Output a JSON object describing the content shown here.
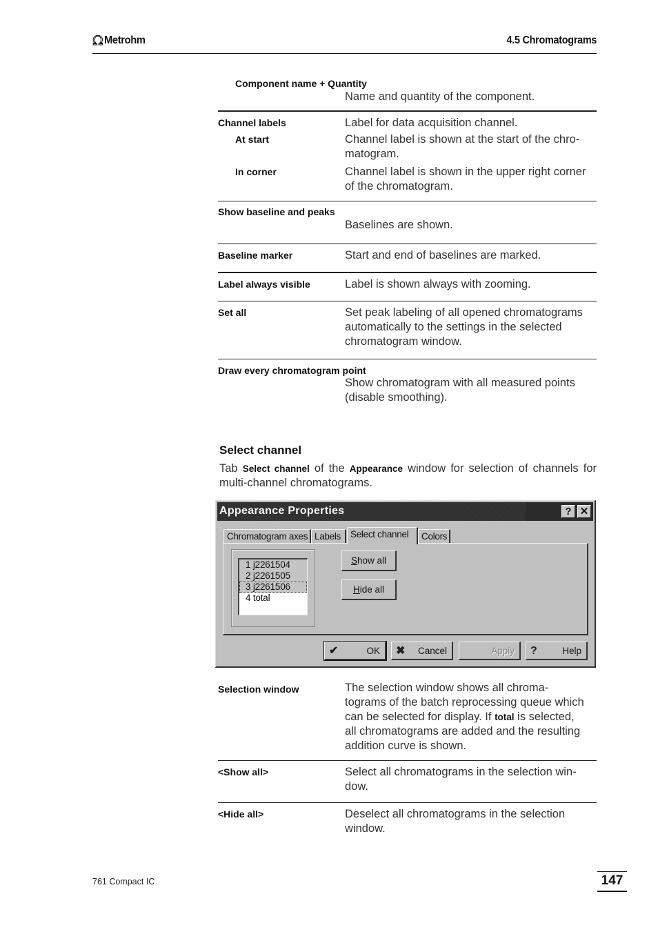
{
  "header": {
    "logo_symbol": "Ω",
    "logo_text": "Metrohm",
    "section": "4.5  Chromatograms"
  },
  "definitions_top": [
    {
      "term": "Component name + Quantity",
      "indent": true,
      "desc": "Name and quantity of the component."
    },
    {
      "term": "Channel labels",
      "desc": "Label for data acquisition channel.",
      "subitems": [
        {
          "term": "At start",
          "desc": "Channel label is shown at the start of the chro-\nmatogram."
        },
        {
          "term": "In corner",
          "desc": "Channel label is shown in the upper right corner\nof the chromatogram."
        }
      ]
    },
    {
      "term": "Show baseline and peaks",
      "desc": "Baselines are shown."
    },
    {
      "term": "Baseline marker",
      "desc": "Start and end of baselines are marked."
    },
    {
      "term": "Label always visible",
      "desc": "Label is shown always with zooming."
    },
    {
      "term": "Set all",
      "desc": "Set peak labeling of all opened chromatograms automatically to the settings in the selected chromatogram window."
    },
    {
      "term": "Draw every chromatogram point",
      "desc": "Show chromatogram with all measured points (disable smoothing)."
    }
  ],
  "select_channel": {
    "heading": "Select channel",
    "intro_parts": [
      "Tab ",
      "Select channel",
      " of the ",
      "Appearance",
      " window for selection of channels for multi-channel chromatograms."
    ]
  },
  "dialog": {
    "title": "Appearance Properties",
    "help_glyph": "?",
    "close_glyph": "✕",
    "tabs": [
      {
        "label": "Chromatogram axes",
        "active": false
      },
      {
        "label": "Labels",
        "active": false
      },
      {
        "label": "Select channel",
        "active": true
      },
      {
        "label": "Colors",
        "active": false
      }
    ],
    "channel_list": [
      {
        "label": "1 j2261504",
        "selected": true,
        "focused": false
      },
      {
        "label": "2 j2261505",
        "selected": true,
        "focused": false
      },
      {
        "label": "3 j2261506",
        "selected": true,
        "focused": true
      },
      {
        "label": "4 total",
        "selected": false,
        "focused": false
      }
    ],
    "show_all": {
      "mnemonic": "S",
      "rest": "how all"
    },
    "hide_all": {
      "mnemonic": "H",
      "rest": "ide all"
    },
    "buttons": {
      "ok": {
        "icon": "✔",
        "label": "OK"
      },
      "cancel": {
        "icon": "✖",
        "label": "Cancel"
      },
      "apply": {
        "icon": "",
        "label": "Apply",
        "disabled": true
      },
      "help": {
        "icon": "?",
        "label": "Help"
      }
    }
  },
  "definitions_bottom": [
    {
      "term": "Selection window",
      "desc_parts": [
        "The selection window shows all chroma-\ntograms of the batch reprocessing queue which\ncan be selected for display. If ",
        "total",
        " is selected,\nall chromatograms are added and the resulting\naddition curve is shown."
      ]
    },
    {
      "term": "<Show all>",
      "desc": "Select all chromatograms in the selection win-\ndow."
    },
    {
      "term": "<Hide all>",
      "desc": "Deselect all chromatograms in the selection\nwindow."
    }
  ],
  "footer": {
    "product": "761 Compact IC",
    "page_number": "147"
  }
}
